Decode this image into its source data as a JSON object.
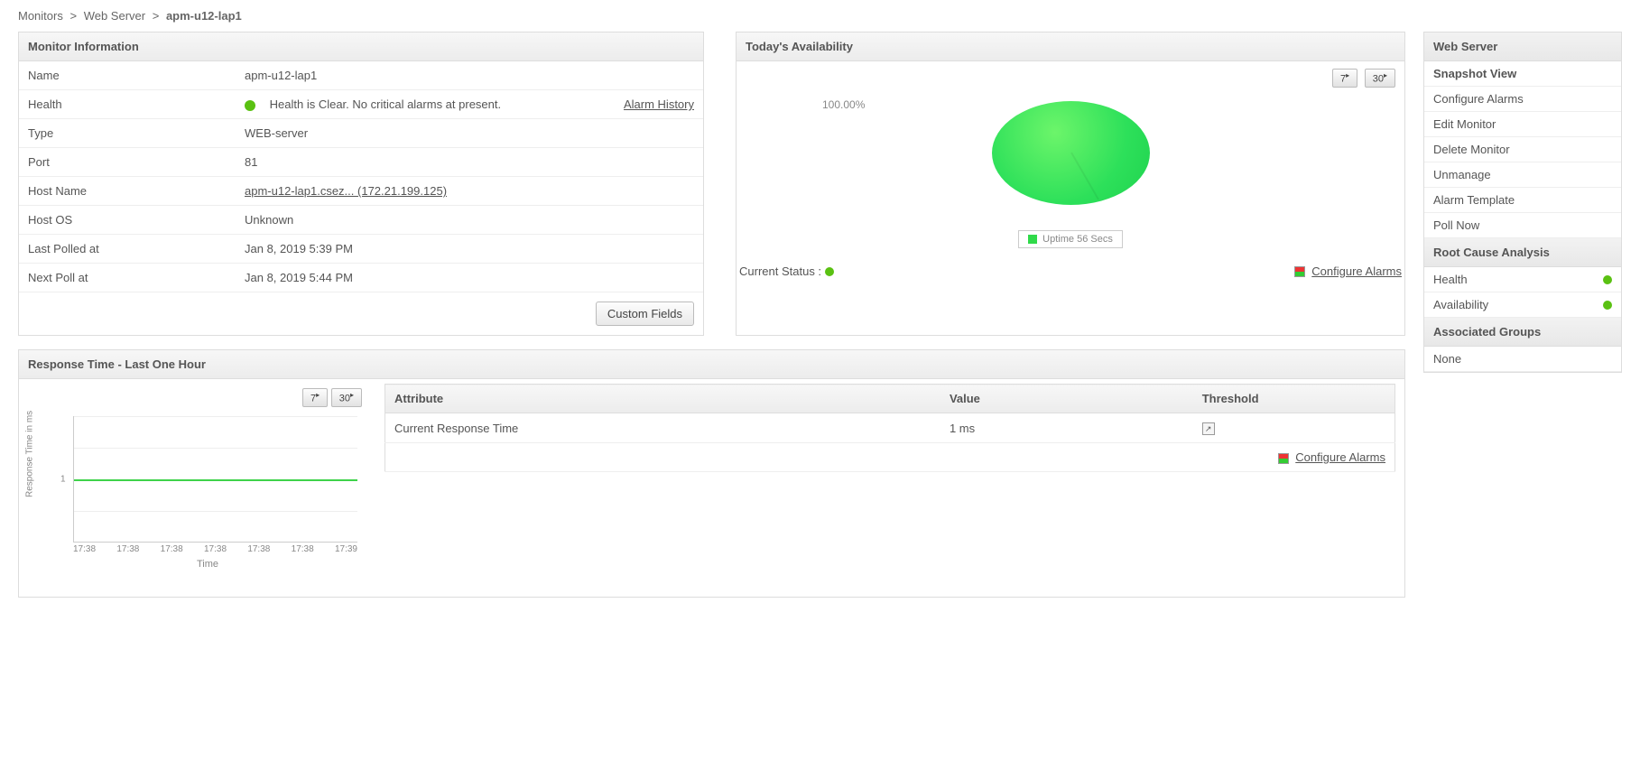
{
  "breadcrumb": {
    "root": "Monitors",
    "group": "Web Server",
    "current": "apm-u12-lap1"
  },
  "monitor_info": {
    "title": "Monitor Information",
    "rows": {
      "name_label": "Name",
      "name_value": "apm-u12-lap1",
      "health_label": "Health",
      "health_value": "Health is Clear. No critical alarms at present.",
      "alarm_history": "Alarm History",
      "type_label": "Type",
      "type_value": "WEB-server",
      "port_label": "Port",
      "port_value": "81",
      "hostname_label": "Host Name",
      "hostname_value": "apm-u12-lap1.csez... (172.21.199.125)",
      "hostos_label": "Host OS",
      "hostos_value": "Unknown",
      "lastpoll_label": "Last Polled at",
      "lastpoll_value": "Jan 8, 2019 5:39 PM",
      "nextpoll_label": "Next Poll at",
      "nextpoll_value": "Jan 8, 2019 5:44 PM"
    },
    "custom_fields_btn": "Custom Fields"
  },
  "availability": {
    "title": "Today's Availability",
    "range7": "7",
    "range30": "30",
    "pct_label": "100.00%",
    "legend": "Uptime 56 Secs",
    "current_status_label": "Current Status :",
    "configure_alarms": "Configure Alarms"
  },
  "response": {
    "title": "Response Time - Last One Hour",
    "range7": "7",
    "range30": "30",
    "y_axis": "Response Time in ms",
    "y_tick": "1",
    "x_axis": "Time",
    "x_ticks": [
      "17:38",
      "17:38",
      "17:38",
      "17:38",
      "17:38",
      "17:38",
      "17:39"
    ],
    "table": {
      "col_attr": "Attribute",
      "col_value": "Value",
      "col_thresh": "Threshold",
      "row_attr": "Current Response Time",
      "row_value": "1 ms",
      "configure_alarms": "Configure Alarms"
    }
  },
  "chart_data": [
    {
      "type": "pie",
      "title": "Today's Availability",
      "series": [
        {
          "name": "Uptime 56 Secs",
          "values": [
            100.0
          ]
        }
      ],
      "categories": [
        "Uptime"
      ],
      "annotations": [
        "100.00%"
      ]
    },
    {
      "type": "line",
      "title": "Response Time - Last One Hour",
      "xlabel": "Time",
      "ylabel": "Response Time in ms",
      "x": [
        "17:38",
        "17:38",
        "17:38",
        "17:38",
        "17:38",
        "17:38",
        "17:39"
      ],
      "series": [
        {
          "name": "Response Time",
          "values": [
            1,
            1,
            1,
            1,
            1,
            1,
            1
          ]
        }
      ],
      "ylim": [
        0,
        2
      ]
    }
  ],
  "sidebar": {
    "web_server": "Web Server",
    "items": [
      "Snapshot View",
      "Configure Alarms",
      "Edit Monitor",
      "Delete Monitor",
      "Unmanage",
      "Alarm Template",
      "Poll Now"
    ],
    "rca": "Root Cause Analysis",
    "health": "Health",
    "availability": "Availability",
    "assoc_groups": "Associated Groups",
    "none": "None"
  }
}
